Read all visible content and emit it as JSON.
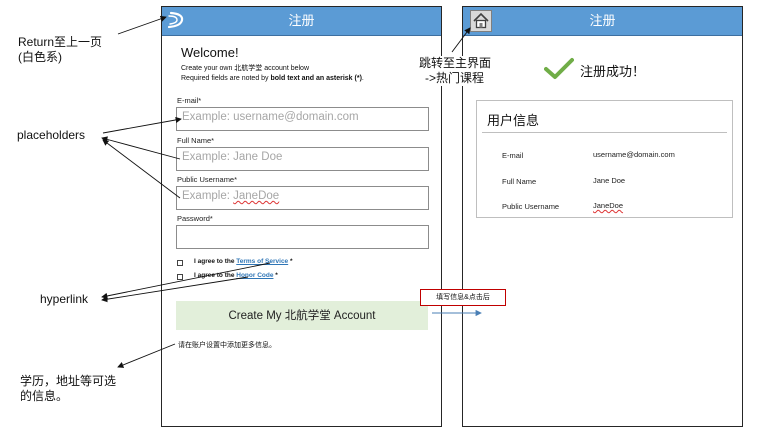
{
  "left_screen": {
    "header_title": "注册",
    "back_icon": "return-arrow-icon",
    "welcome": "Welcome!",
    "intro_line1": "Create your own 北航学堂 account below",
    "intro_line2_prefix": "Required fields are noted by ",
    "intro_line2_bold": "bold text and an asterisk (*)",
    "intro_line2_suffix": ".",
    "email_label": "E-mail*",
    "email_placeholder": "Example: username@domain.com",
    "fullname_label": "Full Name*",
    "fullname_placeholder": "Example: Jane Doe",
    "username_label": "Public Username*",
    "username_placeholder_prefix": "Example: ",
    "username_placeholder_name": "JaneDoe",
    "password_label": "Password*",
    "tos_prefix": "I agree to the ",
    "tos_link": "Terms of Service",
    "tos_suffix": " *",
    "honor_prefix": "I agree to the ",
    "honor_link": "Honor Code",
    "honor_suffix": " *",
    "create_button": "Create My 北航学堂 Account",
    "footer_note": "请在账户设置中添加更多信息。"
  },
  "right_screen": {
    "header_title": "注册",
    "home_icon": "home-icon",
    "success_text": "注册成功！",
    "info_title": "用户信息",
    "rows": [
      {
        "label": "E-mail",
        "value": "username@domain.com"
      },
      {
        "label": "Full Name",
        "value": "Jane Doe"
      },
      {
        "label": "Public Username",
        "value": "JaneDoe"
      }
    ]
  },
  "annotations": {
    "return_line1": "Return至上一页",
    "return_line2": "(白色系)",
    "placeholders": "placeholders",
    "hyperlink": "hyperlink",
    "optional_line1": "学历，地址等可选",
    "optional_line2": "的信息。",
    "home_line1": "跳转至主界面",
    "home_line2": "->热门课程",
    "transition_note": "填写信息&点击后"
  },
  "colors": {
    "header_blue": "#5b9bd5",
    "button_green": "#e2efda",
    "link_blue": "#2e75b6",
    "check_green": "#70ad47",
    "note_border": "#c00000"
  }
}
